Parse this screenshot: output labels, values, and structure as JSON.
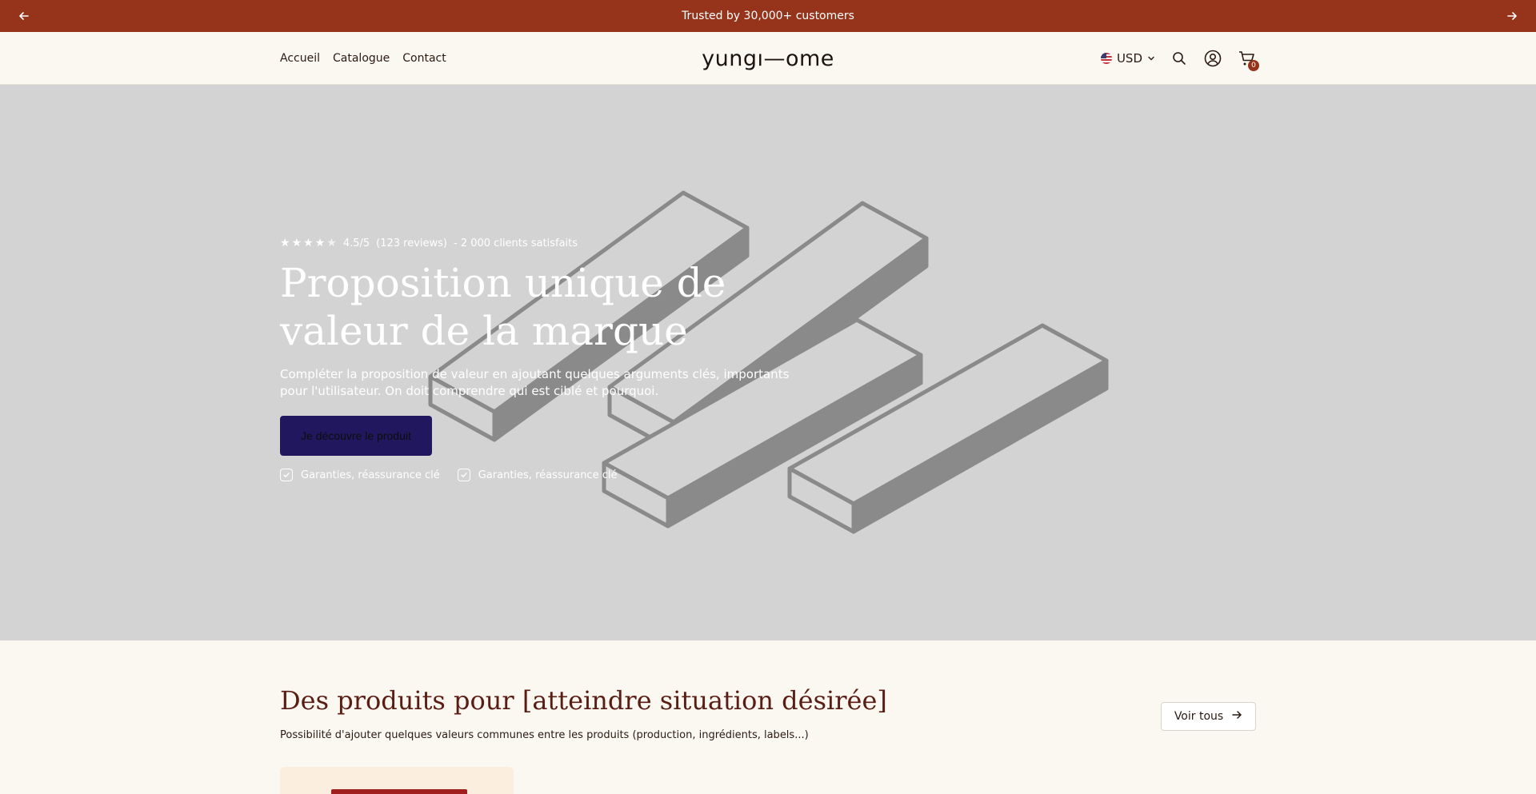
{
  "announcement": {
    "text": "Trusted by 30,000+ customers"
  },
  "nav": {
    "items": [
      "Accueil",
      "Catalogue",
      "Contact"
    ]
  },
  "brand": {
    "logo": "yungı—ome"
  },
  "header": {
    "currency": "USD",
    "cart_count": "0"
  },
  "hero": {
    "rating_value": "4.5/5",
    "rating_reviews": "(123 reviews)",
    "rating_clients": "- 2 000 clients satisfaits",
    "stars": 4.5,
    "title_line1": "Proposition unique de",
    "title_line2": "valeur de la marque",
    "subtitle": "Compléter la proposition de valeur en ajoutant quelques arguments clés, importants pour l'utilisateur. On doit comprendre qui est ciblé et pourquoi.",
    "cta": "Je découvre le produit",
    "guarantees": [
      "Garanties, réassurance clé",
      "Garanties, réassurance clé"
    ]
  },
  "products": {
    "title": "Des produits pour [atteindre situation désirée]",
    "subtitle": "Possibilité d'ajouter quelques valeurs communes entre les produits (production, ingrédients, labels...)",
    "see_all": "Voir tous"
  },
  "colors": {
    "announcement_bg": "#96341b",
    "page_bg": "#fbf7f1",
    "hero_bg": "#d3d3d3",
    "cta_bg": "#21175e",
    "section_title": "#5a1d14"
  },
  "icons": [
    "arrow-left-icon",
    "arrow-right-icon",
    "us-flag-icon",
    "chevron-down-icon",
    "search-icon",
    "account-icon",
    "cart-icon",
    "star-icon",
    "check-icon"
  ]
}
